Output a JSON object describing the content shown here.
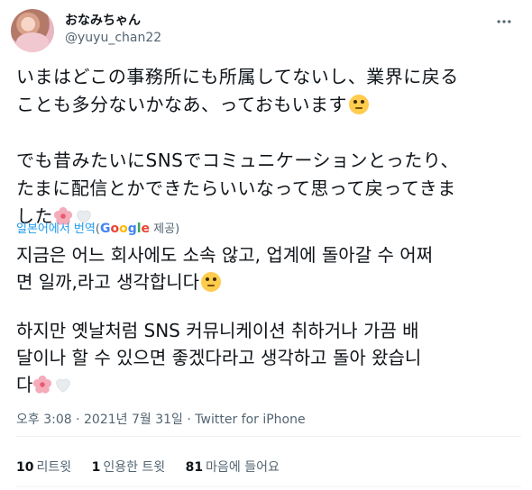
{
  "author": {
    "display_name": "おなみちゃん",
    "handle": "@yuyu_chan22"
  },
  "tweet": {
    "lines_p1": [
      "いまはどこの事務所にも所属してないし、業界に戻る",
      "ことも多分ないかなあ、っておもいます"
    ],
    "lines_p2": [
      "でも昔みたいにSNSでコミュニケーションとったり、",
      "たまに配信とかできたらいいなって思って戻ってきま",
      "した"
    ]
  },
  "translation": {
    "label": "일본어에서 번역",
    "by_open": "(",
    "by_close": " 제공)",
    "provider": "Google",
    "lines_p1": [
      "지금은 어느 회사에도 소속 않고, 업계에 돌아갈 수 어쩌",
      "면 일까,라고 생각합니다"
    ],
    "lines_p2": [
      " 하지만 옛날처럼 SNS 커뮤니케이션 취하거나 가끔 배",
      "달이나 할 수 있으면 좋겠다라고 생각하고 돌아 왔습니",
      "다"
    ]
  },
  "meta": {
    "time": "오후 3:08",
    "sep1": " · ",
    "date": "2021년 7월 31일",
    "sep2": " · ",
    "source": "Twitter for iPhone"
  },
  "stats": {
    "retweets": {
      "count": "10",
      "label": "리트윗"
    },
    "quotes": {
      "count": "1",
      "label": "인용한 트윗"
    },
    "likes": {
      "count": "81",
      "label": "마음에 들어요"
    }
  },
  "icons": {
    "more": "more-horizontal-icon",
    "face": "face-with-rolling-eyes-emoji",
    "blossom": "cherry-blossom-emoji",
    "heart": "white-heart-emoji"
  },
  "colors": {
    "text": "#0f1419",
    "secondary": "#536471",
    "link": "#1d9bf0",
    "divider": "#eff3f4"
  }
}
